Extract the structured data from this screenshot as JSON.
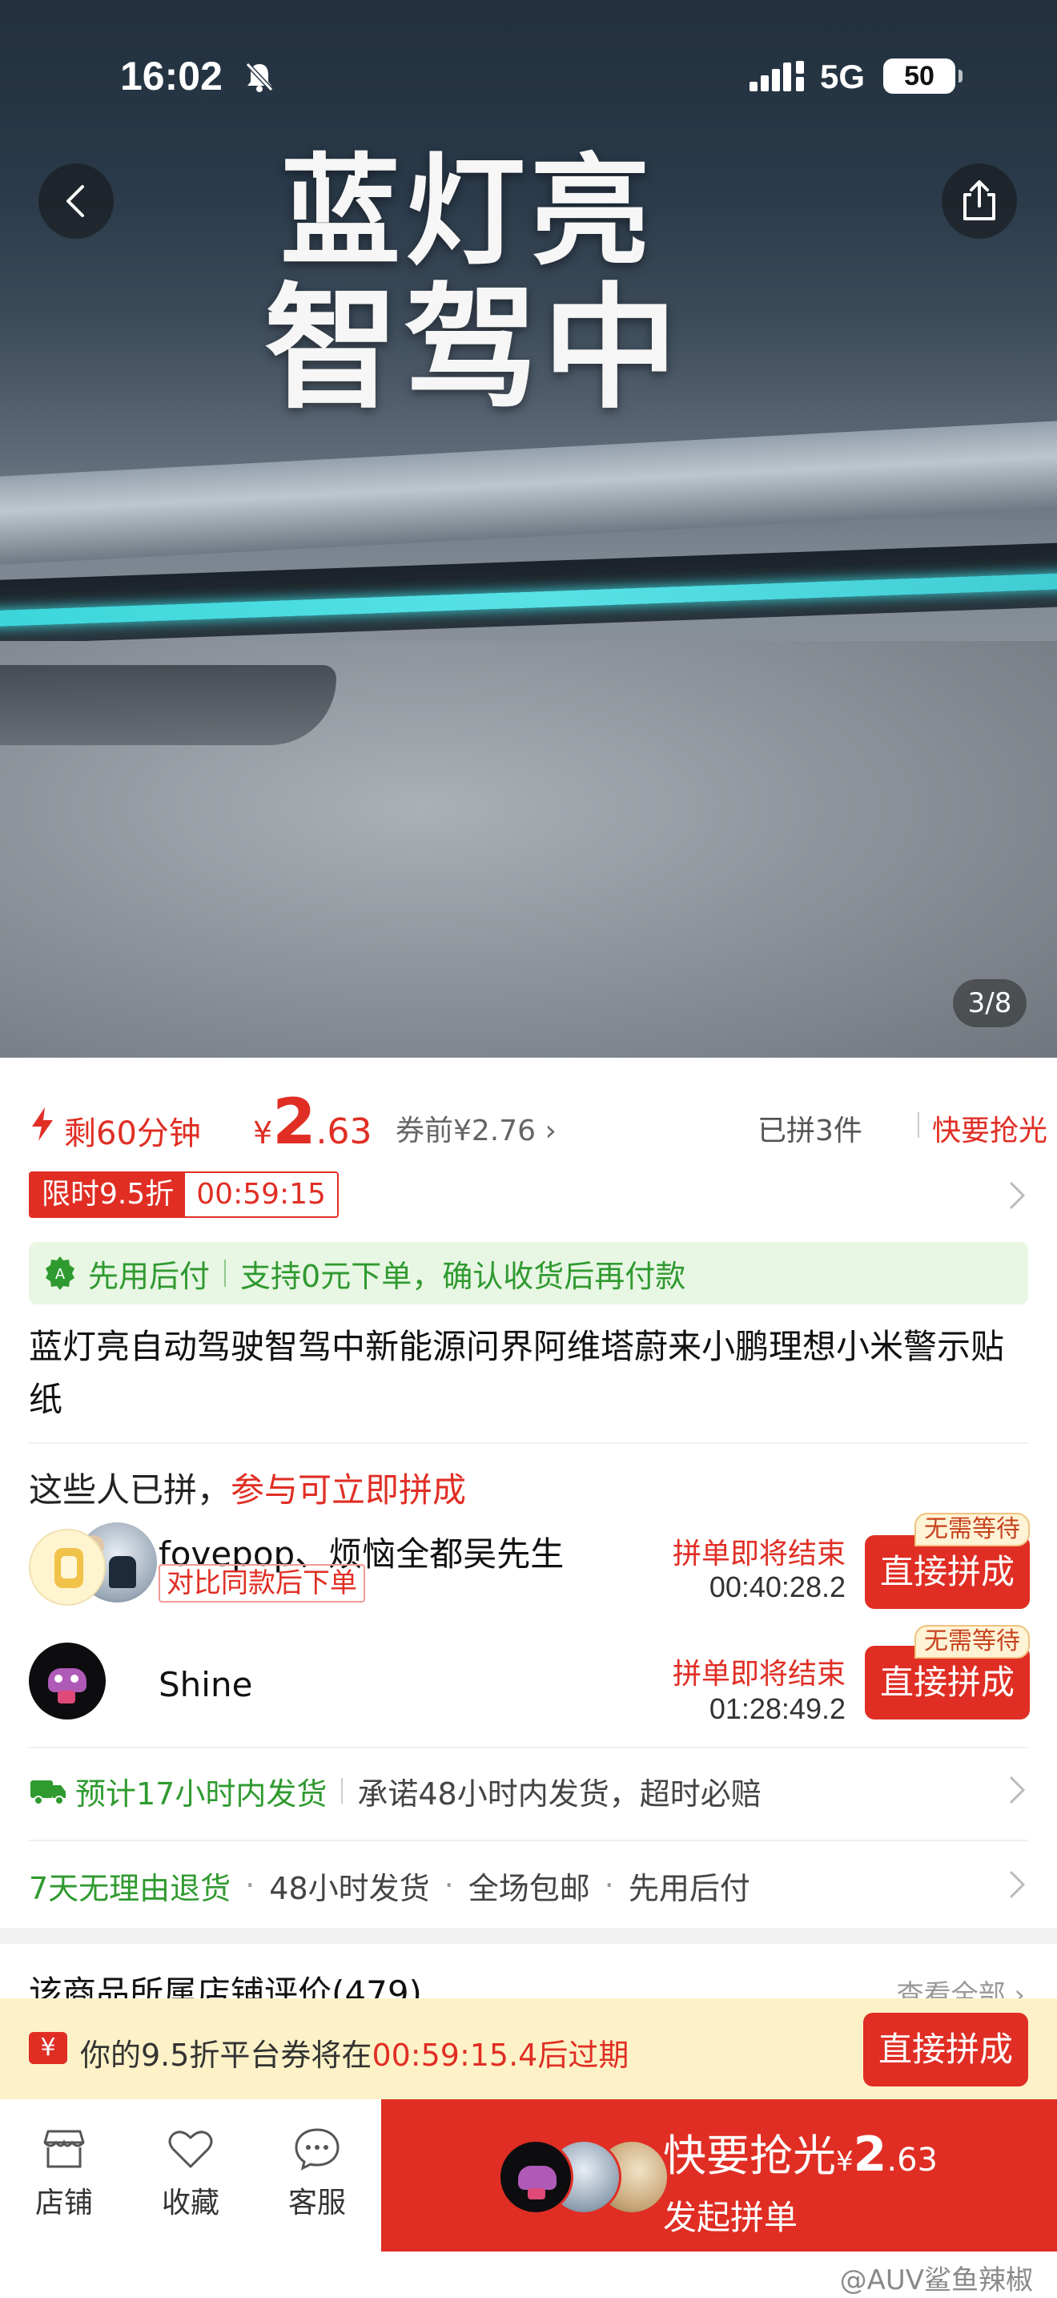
{
  "status_bar": {
    "time": "16:02",
    "network": "5G",
    "battery": "50"
  },
  "hero": {
    "title_line1": "蓝灯亮",
    "title_line2": "智驾中",
    "image_counter": "3/8"
  },
  "price_row": {
    "remaining": "剩60分钟",
    "currency": "¥",
    "price_int": "2",
    "price_dec": ".63",
    "before_coupon": "券前¥2.76",
    "sold": "已拼3件",
    "hurry": "快要抢光"
  },
  "discount": {
    "label": "限时9.5折",
    "countdown": "00:59:15"
  },
  "pay_later": {
    "label": "先用后付",
    "desc": "支持0元下单，确认收货后再付款"
  },
  "product": {
    "title": "蓝灯亮自动驾驶智驾中新能源问界阿维塔蔚来小鹏理想小米警示贴纸"
  },
  "group_buy": {
    "title_prefix": "这些人已拼，",
    "title_red": "参与可立即拼成",
    "groups": [
      {
        "names": "fovepop、烦恼全都吴先生",
        "tag": "对比同款后下单",
        "status": "拼单即将结束",
        "timer": "00:40:28.2",
        "badge": "无需等待",
        "button": "直接拼成"
      },
      {
        "names": "Shine",
        "tag": "",
        "status": "拼单即将结束",
        "timer": "01:28:49.2",
        "badge": "无需等待",
        "button": "直接拼成"
      }
    ]
  },
  "shipping": {
    "estimate": "预计17小时内发货",
    "promise": "承诺48小时内发货，超时必赔"
  },
  "services": [
    "7天无理由退货",
    "48小时发货",
    "全场包邮",
    "先用后付"
  ],
  "reviews": {
    "title": "该商品所属店铺评价(479)",
    "view_all": "查看全部"
  },
  "coupon_bar": {
    "icon": "¥",
    "prefix": "你的9.5折平台券将在",
    "time": "00:59:15.4",
    "suffix": "后过期",
    "button": "直接拼成"
  },
  "bottom_nav": {
    "shop": "店铺",
    "favorite": "收藏",
    "service": "客服",
    "cta_main": "快要抢光",
    "cta_currency": "¥",
    "cta_price_int": "2",
    "cta_price_dec": ".63",
    "cta_sub": "发起拼单"
  },
  "watermark": "@AUV鲨鱼辣椒",
  "colors": {
    "accent": "#e02e24",
    "green": "#2f9a2f",
    "coupon_bg": "#fdf2c7",
    "paylater_bg": "#e8f6e4"
  },
  "icons": [
    "back-icon",
    "share-icon",
    "flash-icon",
    "shield-check-icon",
    "truck-icon",
    "chevron-right-icon",
    "store-icon",
    "heart-icon",
    "chat-icon",
    "bell-muted-icon",
    "signal-icon"
  ]
}
